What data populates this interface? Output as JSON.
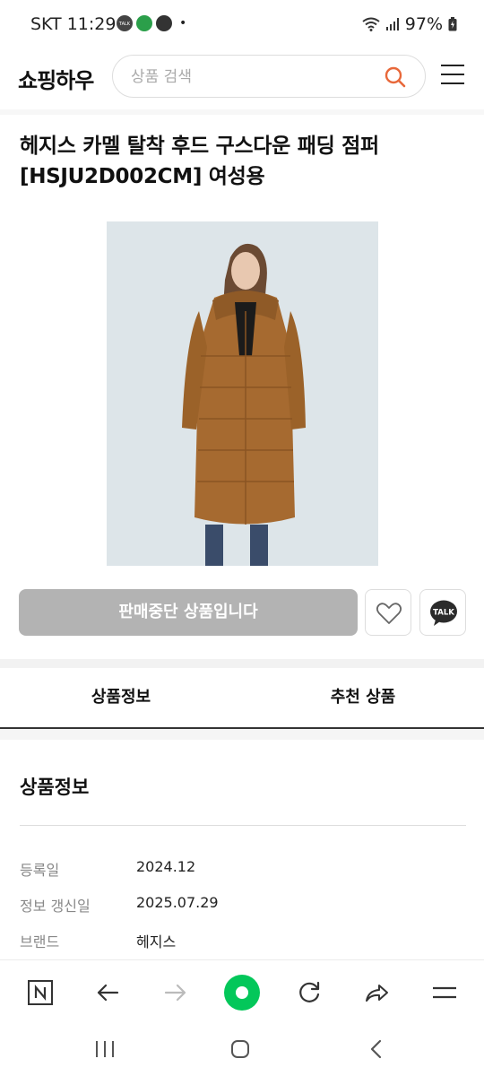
{
  "status": {
    "carrier_time": "SKT 11:29",
    "icons": [
      "talk-icon",
      "location-icon",
      "bike-icon"
    ],
    "dot": "•",
    "battery": "97%"
  },
  "header": {
    "logo": "쇼핑하우",
    "search_placeholder": "상품 검색"
  },
  "product": {
    "title": "헤지스 카멜 탈착 후드 구스다운 패딩 점퍼 [HSJU2D002CM] 여성용",
    "soldout_label": "판매중단 상품입니다",
    "talk_label": "TALK"
  },
  "tabs": [
    {
      "label": "상품정보"
    },
    {
      "label": "추천 상품"
    }
  ],
  "info": {
    "section_title": "상품정보",
    "rows": [
      {
        "key": "등록일",
        "value": "2024.12"
      },
      {
        "key": "정보 갱신일",
        "value": "2025.07.29"
      },
      {
        "key": "브랜드",
        "value": "헤지스"
      }
    ]
  },
  "colors": {
    "accent_orange": "#e8683a",
    "soldout_gray": "#b3b3b3",
    "naver_green": "#03c75a",
    "coat": "#a66a30"
  }
}
